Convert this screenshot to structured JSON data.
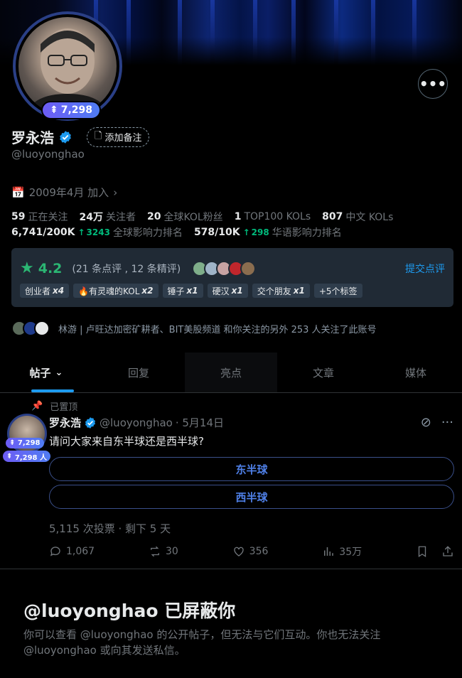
{
  "profile": {
    "avatar_badge": "7,298",
    "display_name": "罗永浩",
    "handle": "@luoyonghao",
    "add_note_label": "添加备注",
    "joined": "2009年4月 加入"
  },
  "stats_row1": [
    {
      "value": "59",
      "label": "正在关注"
    },
    {
      "value": "24万",
      "label": "关注者"
    },
    {
      "value": "20",
      "label": "全球KOL粉丝"
    },
    {
      "value": "1",
      "label": "TOP100 KOLs"
    },
    {
      "value": "807",
      "label": "中文 KOLs"
    }
  ],
  "stats_row2": [
    {
      "value": "6,741/200K",
      "delta": "3243",
      "label": "全球影响力排名"
    },
    {
      "value": "578/10K",
      "delta": "298",
      "label": "华语影响力排名"
    }
  ],
  "rating": {
    "score": "4.2",
    "meta": "(21 条点评 , 12 条精评)",
    "submit_label": "提交点评",
    "tags": [
      {
        "label": "创业者",
        "count": "x4"
      },
      {
        "label": "🔥有灵魂的KOL",
        "count": "x2"
      },
      {
        "label": "锤子",
        "count": "x1"
      },
      {
        "label": "硬汉",
        "count": "x1"
      },
      {
        "label": "交个朋友",
        "count": "x1"
      },
      {
        "label": "+5个标签",
        "count": ""
      }
    ]
  },
  "followed_by": "林游 | 卢旺达加密矿耕者、BIT美股频道 和你关注的另外 253 人关注了此账号",
  "tabs": [
    "帖子",
    "回复",
    "亮点",
    "文章",
    "媒体"
  ],
  "post": {
    "pinned_label": "已置顶",
    "avatar_badge1": "7,298",
    "avatar_badge2": "7,298 人",
    "author": "罗永浩",
    "handle": "@luoyonghao",
    "date": "· 5月14日",
    "text": "请问大家来自东半球还是西半球?",
    "poll_options": [
      "东半球",
      "西半球"
    ],
    "poll_meta": "5,115 次投票 · 剩下 5 天",
    "replies": "1,067",
    "reposts": "30",
    "likes": "356",
    "views": "35万"
  },
  "blocked": {
    "title": "@luoyonghao 已屏蔽你",
    "description": "你可以查看 @luoyonghao 的公开帖子，但无法与它们互动。你也无法关注 @luoyonghao 或向其发送私信。"
  }
}
